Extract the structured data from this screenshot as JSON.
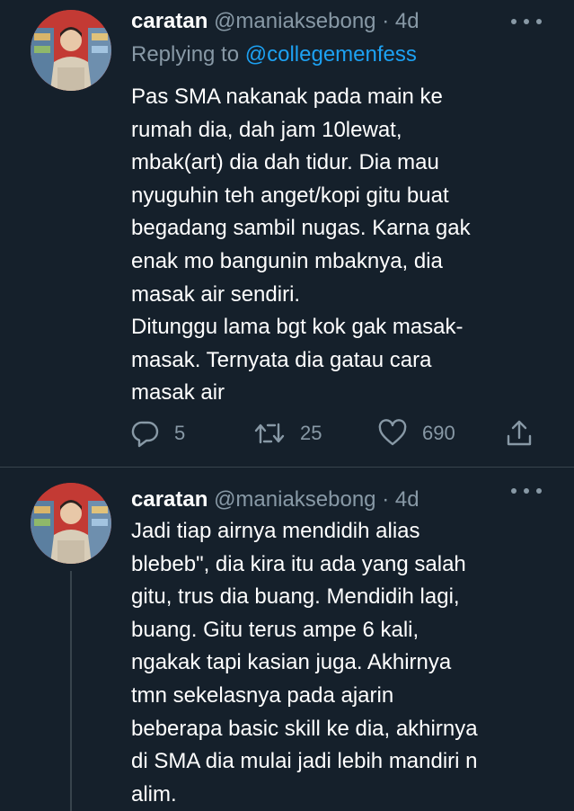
{
  "tweets": [
    {
      "display_name": "caratan",
      "handle": "@maniaksebong",
      "time": "· 4d",
      "replying_label": "Replying to ",
      "replying_to": "@collegemenfess",
      "text": "Pas SMA nakanak pada main ke\nrumah dia, dah jam 10lewat,\nmbak(art) dia dah tidur. Dia mau\nnyuguhin teh anget/kopi gitu buat\nbegadang sambil nugas. Karna gak\nenak mo bangunin mbaknya, dia\nmasak air sendiri.\nDitunggu lama bgt kok gak masak-\nmasak. Ternyata dia gatau cara\nmasak air",
      "replies": "5",
      "retweets": "25",
      "likes": "690"
    },
    {
      "display_name": "caratan",
      "handle": "@maniaksebong",
      "time": "· 4d",
      "text": "Jadi tiap airnya mendidih alias\nblebeb\", dia kira itu ada yang salah\ngitu, trus dia buang. Mendidih lagi,\nbuang. Gitu terus ampe 6 kali,\nngakak tapi kasian juga. Akhirnya\ntmn sekelasnya pada ajarin\nbeberapa basic skill ke dia, akhirnya\ndi SMA dia mulai jadi lebih mandiri n\nalim."
    }
  ],
  "icons": {
    "more": "more-horizontal-icon",
    "reply": "reply-icon",
    "retweet": "retweet-icon",
    "like": "heart-icon",
    "share": "share-icon"
  },
  "colors": {
    "background": "#15202b",
    "secondary_text": "#8899a6",
    "accent": "#1da1f2",
    "divider": "#38444d"
  }
}
